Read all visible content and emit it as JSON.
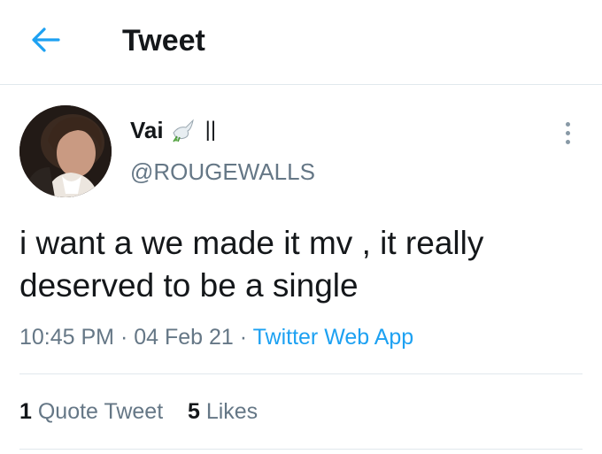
{
  "header": {
    "title": "Tweet",
    "back_icon": "arrow-left-icon"
  },
  "colors": {
    "accent": "#1da1f2",
    "secondary_text": "#657786",
    "primary_text": "#14171a",
    "divider": "#e1e8ed"
  },
  "tweet": {
    "author": {
      "display_name": "Vai",
      "name_suffix": "||",
      "handle": "@ROUGEWALLS",
      "badge_icon": "dove-icon"
    },
    "text": "i want a we made it mv , it really\ndeserved to be a single",
    "time": "10:45 PM",
    "separator": "·",
    "date": "04 Feb 21",
    "source": "Twitter Web App",
    "more_icon": "more-vertical-icon"
  },
  "stats": {
    "quote_count": "1",
    "quote_label": "Quote Tweet",
    "likes_count": "5",
    "likes_label": "Likes"
  }
}
